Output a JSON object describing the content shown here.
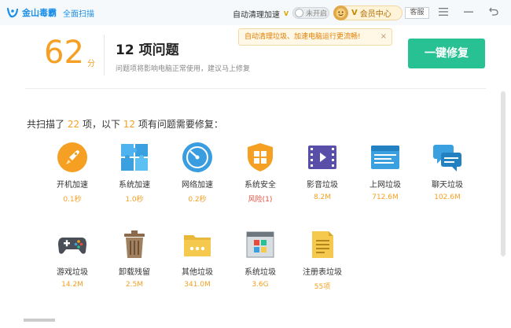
{
  "titlebar": {
    "app_name": "金山毒霸",
    "section": "全面扫描",
    "auto_clean_label": "自动清理加速",
    "auto_clean_badge": "V",
    "auto_clean_state": "未开启",
    "vip_badge": "V",
    "vip_label": "会员中心",
    "service_label": "客服"
  },
  "tooltip": {
    "text": "自动清理垃圾、加速电脑运行更流畅!",
    "close": "×"
  },
  "header": {
    "score": "62",
    "score_unit": "分",
    "issue_title": "12 项问题",
    "issue_desc": "问题项将影响电脑正常使用，建议马上修复",
    "fix_button": "一键修复"
  },
  "summary": {
    "prefix": "共扫描了",
    "scanned": "22",
    "middle": "项，以下",
    "issues": "12",
    "suffix": "项有问题需要修复："
  },
  "items": [
    {
      "label": "开机加速",
      "value": "0.1秒",
      "icon": "rocket-icon"
    },
    {
      "label": "系统加速",
      "value": "1.0秒",
      "icon": "puzzle-icon"
    },
    {
      "label": "网络加速",
      "value": "0.2秒",
      "icon": "speedometer-icon"
    },
    {
      "label": "系统安全",
      "value": "风险(1)",
      "icon": "windows-shield-icon"
    },
    {
      "label": "影音垃圾",
      "value": "8.2M",
      "icon": "film-icon"
    },
    {
      "label": "上网垃圾",
      "value": "712.6M",
      "icon": "browser-window-icon"
    },
    {
      "label": "聊天垃圾",
      "value": "102.6M",
      "icon": "chat-bubbles-icon"
    },
    {
      "label": "游戏垃圾",
      "value": "14.2M",
      "icon": "gamepad-icon"
    },
    {
      "label": "卸载残留",
      "value": "2.5M",
      "icon": "trash-can-icon"
    },
    {
      "label": "其他垃圾",
      "value": "341.0M",
      "icon": "folder-dots-icon"
    },
    {
      "label": "系统垃圾",
      "value": "3.6G",
      "icon": "windows-window-icon"
    },
    {
      "label": "注册表垃圾",
      "value": "55项",
      "icon": "registry-doc-icon"
    }
  ],
  "colors": {
    "accent_orange": "#f5a023",
    "fix_green": "#27c193",
    "brand_blue": "#1b8fe8",
    "risk_red": "#e84b3c"
  }
}
